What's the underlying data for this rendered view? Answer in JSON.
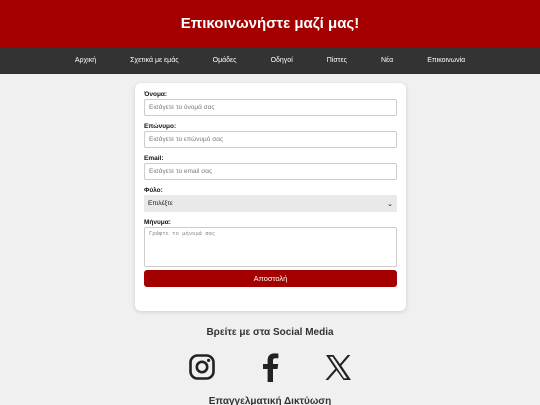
{
  "header": {
    "title": "Επικοινωνήστε μαζί μας!"
  },
  "nav": {
    "items": [
      "Αρχική",
      "Σχετικά με εμάς",
      "Ομάδες",
      "Οδηγοί",
      "Πίστες",
      "Νέα",
      "Επικοινωνία"
    ]
  },
  "form": {
    "first_name": {
      "label": "Όνομα:",
      "placeholder": "Εισάγετε το όνομά σας"
    },
    "last_name": {
      "label": "Επώνυμο:",
      "placeholder": "Εισάγετε το επώνυμό σας"
    },
    "email": {
      "label": "Email:",
      "placeholder": "Εισάγετε το email σας"
    },
    "gender": {
      "label": "Φύλο:",
      "selected": "Επιλέξτε"
    },
    "message": {
      "label": "Μήνυμα:",
      "placeholder": "Γράψτε το μήνυμά σας"
    },
    "submit_label": "Αποστολή"
  },
  "social": {
    "title": "Βρείτε με στα Social Media",
    "icons": [
      "instagram-icon",
      "facebook-icon",
      "x-icon"
    ]
  },
  "footer": {
    "title": "Επαγγελματική Δικτύωση"
  },
  "colors": {
    "brand": "#a50000",
    "nav_bg": "#333333",
    "page_bg": "#f0f0f0"
  }
}
